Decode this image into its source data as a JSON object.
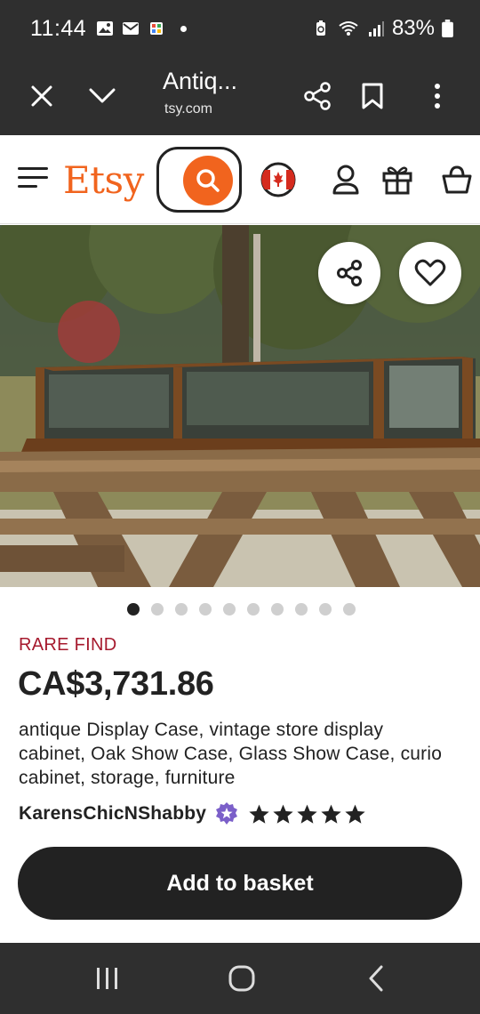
{
  "status_bar": {
    "time": "11:44",
    "battery": "83%"
  },
  "browser": {
    "title": "Antiq...",
    "url": "tsy.com"
  },
  "header": {
    "logo": "Etsy"
  },
  "carousel": {
    "total": 10,
    "active_index": 0
  },
  "listing": {
    "badge": "RARE FIND",
    "price": "CA$3,731.86",
    "title": "antique Display Case, vintage store display cabinet, Oak Show Case, Glass Show Case, curio cabinet, storage, furniture",
    "shop_name": "KarensChicNShabby",
    "rating_stars": 5,
    "add_button": "Add to basket"
  },
  "colors": {
    "etsy_orange": "#f1641e",
    "rare_find_red": "#a61a2e",
    "star_seller_purple": "#7b5fc9",
    "dark": "#222222",
    "system_bar": "#2f2f2f"
  },
  "icons": {
    "status": [
      "image-icon",
      "mail-icon",
      "app-icon",
      "notification-dot",
      "battery-saver-icon",
      "wifi-icon",
      "signal-icon",
      "battery-icon"
    ],
    "browser": [
      "close-icon",
      "chevron-down-icon",
      "share-icon",
      "bookmark-icon",
      "more-vert-icon"
    ],
    "header": [
      "menu-icon",
      "search-icon",
      "canada-flag-icon",
      "account-icon",
      "gift-icon",
      "basket-icon"
    ],
    "navigation": [
      "recents-icon",
      "home-icon",
      "back-icon"
    ]
  }
}
